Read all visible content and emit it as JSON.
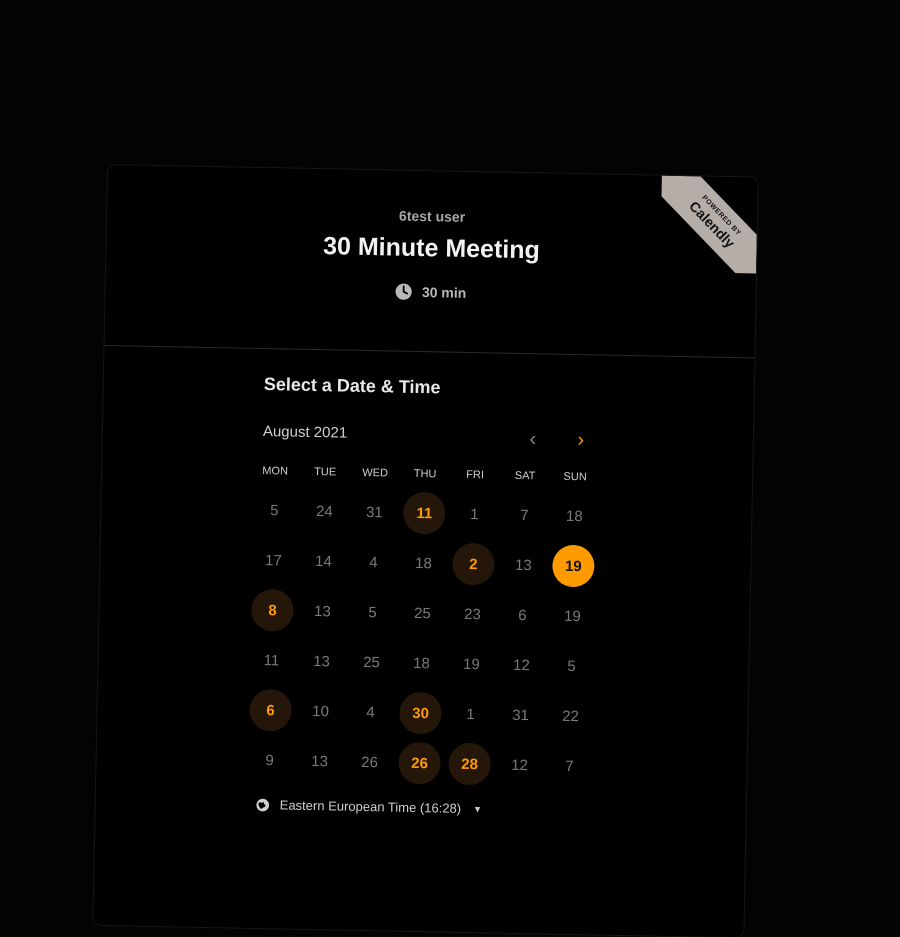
{
  "header": {
    "organizer": "6test user",
    "title": "30 Minute Meeting",
    "duration": "30 min",
    "duration_icon": "clock-icon"
  },
  "badge": {
    "top": "POWERED BY",
    "brand": "Calendly",
    "color": "#b4ada8"
  },
  "scheduler": {
    "title": "Select a Date & Time",
    "month": "August 2021",
    "prev_icon": "chevron-left-icon",
    "next_icon": "chevron-right-icon",
    "weekdays": [
      "MON",
      "TUE",
      "WED",
      "THU",
      "FRI",
      "SAT",
      "SUN"
    ],
    "rows": [
      [
        {
          "d": "5",
          "s": "n"
        },
        {
          "d": "24",
          "s": "n"
        },
        {
          "d": "31",
          "s": "n"
        },
        {
          "d": "11",
          "s": "a"
        },
        {
          "d": "1",
          "s": "n"
        },
        {
          "d": "7",
          "s": "n"
        },
        {
          "d": "18",
          "s": "n"
        }
      ],
      [
        {
          "d": "17",
          "s": "n"
        },
        {
          "d": "14",
          "s": "n"
        },
        {
          "d": "4",
          "s": "n"
        },
        {
          "d": "18",
          "s": "n"
        },
        {
          "d": "2",
          "s": "a"
        },
        {
          "d": "13",
          "s": "n"
        },
        {
          "d": "19",
          "s": "sel"
        }
      ],
      [
        {
          "d": "8",
          "s": "a"
        },
        {
          "d": "13",
          "s": "n"
        },
        {
          "d": "5",
          "s": "n"
        },
        {
          "d": "25",
          "s": "n"
        },
        {
          "d": "23",
          "s": "n"
        },
        {
          "d": "6",
          "s": "n"
        },
        {
          "d": "19",
          "s": "n"
        }
      ],
      [
        {
          "d": "11",
          "s": "n"
        },
        {
          "d": "13",
          "s": "n"
        },
        {
          "d": "25",
          "s": "n"
        },
        {
          "d": "18",
          "s": "n"
        },
        {
          "d": "19",
          "s": "n"
        },
        {
          "d": "12",
          "s": "n"
        },
        {
          "d": "5",
          "s": "n"
        }
      ],
      [
        {
          "d": "6",
          "s": "a"
        },
        {
          "d": "10",
          "s": "n"
        },
        {
          "d": "4",
          "s": "n"
        },
        {
          "d": "30",
          "s": "a"
        },
        {
          "d": "1",
          "s": "n"
        },
        {
          "d": "31",
          "s": "n"
        },
        {
          "d": "22",
          "s": "n"
        }
      ],
      [
        {
          "d": "9",
          "s": "n"
        },
        {
          "d": "13",
          "s": "n"
        },
        {
          "d": "26",
          "s": "n"
        },
        {
          "d": "26",
          "s": "a"
        },
        {
          "d": "28",
          "s": "a"
        },
        {
          "d": "12",
          "s": "n"
        },
        {
          "d": "7",
          "s": "n"
        }
      ]
    ],
    "timezone": "Eastern European Time (16:28)",
    "timezone_icon": "globe-icon"
  },
  "colors": {
    "accent": "#ff9a00",
    "available_bg": "#24170a",
    "background": "#000000"
  }
}
